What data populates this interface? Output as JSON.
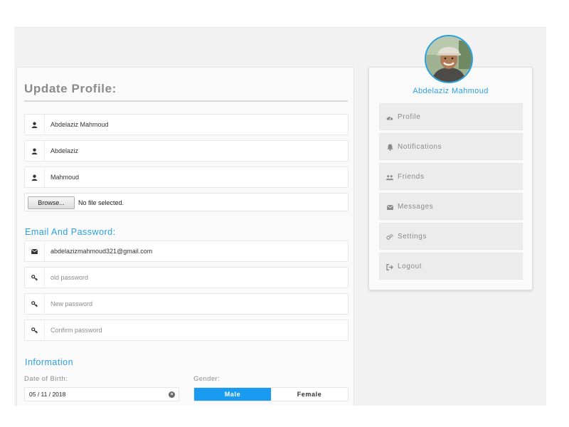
{
  "update_profile": {
    "title": "Update Profile:",
    "full_name_value": "Abdelaziz Mahmoud",
    "first_name_value": "Abdelaziz",
    "last_name_value": "Mahmoud",
    "browse_label": "Browse...",
    "file_status": "No file selected."
  },
  "email_password": {
    "title": "Email And Password:",
    "email_value": "abdelazizmahmoud321@gmail.com",
    "old_password_placeholder": "old password",
    "new_password_placeholder": "New password",
    "confirm_password_placeholder": "Confirm password"
  },
  "information": {
    "title": "Information",
    "dob_label": "Date of Birth:",
    "dob_value": "05 / 11 / 2018",
    "gender_label": "Gender:",
    "gender_options": [
      "Male",
      "Female"
    ],
    "gender_selected": "Male"
  },
  "profile_card": {
    "name": "Abdelaziz Mahmoud",
    "menu": [
      {
        "label": "Profile",
        "icon": "dashboard-icon"
      },
      {
        "label": "Notifications",
        "icon": "bell-icon"
      },
      {
        "label": "Friends",
        "icon": "users-icon"
      },
      {
        "label": "Messages",
        "icon": "envelope-icon"
      },
      {
        "label": "Settings",
        "icon": "cogs-icon"
      },
      {
        "label": "Logout",
        "icon": "sign-out-icon"
      }
    ]
  },
  "icons": {
    "user_rows": "user-icon",
    "email_row": "envelope-icon",
    "password_rows": "key-icon"
  },
  "colors": {
    "accent": "#2aa1e3",
    "active_toggle": "#1a9bf2",
    "stage_bg": "#f2f2f2",
    "muted_text": "#8a8a8a"
  }
}
